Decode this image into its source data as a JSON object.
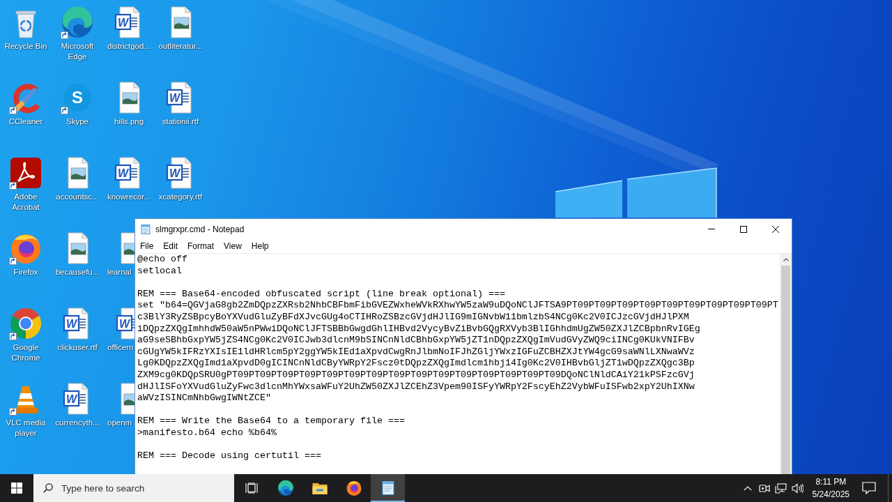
{
  "desktop_icons": [
    {
      "label": "Recycle Bin",
      "kind": "recycle-bin",
      "shortcut": false,
      "covered": false
    },
    {
      "label": "CCleaner",
      "kind": "ccleaner",
      "shortcut": true,
      "covered": false
    },
    {
      "label": "Adobe Acrobat",
      "kind": "acrobat",
      "shortcut": true,
      "covered": false
    },
    {
      "label": "Firefox",
      "kind": "firefox",
      "shortcut": true,
      "covered": false
    },
    {
      "label": "Google Chrome",
      "kind": "chrome",
      "shortcut": true,
      "covered": false
    },
    {
      "label": "VLC media player",
      "kind": "vlc",
      "shortcut": true,
      "covered": false
    },
    {
      "label": "Microsoft Edge",
      "kind": "edge",
      "shortcut": true,
      "covered": false
    },
    {
      "label": "Skype",
      "kind": "skype",
      "glyph": "S",
      "shortcut": true,
      "covered": false
    },
    {
      "label": "accountsc...",
      "kind": "image-file",
      "shortcut": false,
      "covered": false
    },
    {
      "label": "becausefu...",
      "kind": "image-file",
      "shortcut": false,
      "covered": false
    },
    {
      "label": "clickuser.rtf",
      "kind": "word-doc",
      "glyph": "W",
      "shortcut": false,
      "covered": false
    },
    {
      "label": "currencyth...",
      "kind": "word-doc",
      "glyph": "W",
      "shortcut": false,
      "covered": false
    },
    {
      "label": "districtgod...",
      "kind": "word-doc",
      "glyph": "W",
      "shortcut": false,
      "covered": false
    },
    {
      "label": "hills.png",
      "kind": "image-file",
      "shortcut": false,
      "covered": false
    },
    {
      "label": "knowrecor...",
      "kind": "word-doc",
      "glyph": "W",
      "shortcut": false,
      "covered": false
    },
    {
      "label": "learnal",
      "kind": "image-file",
      "shortcut": false,
      "covered": true
    },
    {
      "label": "officern",
      "kind": "word-doc",
      "glyph": "W",
      "shortcut": false,
      "covered": true
    },
    {
      "label": "openm",
      "kind": "image-file",
      "shortcut": false,
      "covered": true
    },
    {
      "label": "outliteratur...",
      "kind": "image-file",
      "shortcut": false,
      "covered": false
    },
    {
      "label": "stationii.rtf",
      "kind": "word-doc",
      "glyph": "W",
      "shortcut": false,
      "covered": false
    },
    {
      "label": "xcategory.rtf",
      "kind": "word-doc",
      "glyph": "W",
      "shortcut": false,
      "covered": false
    }
  ],
  "notepad": {
    "title": "slmgrxpr.cmd - Notepad",
    "menu": [
      "File",
      "Edit",
      "Format",
      "View",
      "Help"
    ],
    "blocks": [
      [
        "@echo off",
        "setlocal"
      ],
      [
        "REM === Base64-encoded obfuscated script (line break optional) ===",
        "set \"b64=QGVjaG8gb2ZmDQpzZXRsb2NhbCBFbmFibGVEZWxheWVkRXhwYW5zaW9uDQoNClJFTSA9PT09PT09PT09PT09PT09PT09PT09PT09PT09PT",
        "c3BlY3RyZSBpcyBoYXVudGluZyBFdXJvcGUg4oCTIHRoZSBzcGVjdHJlIG9mIGNvbW11bmlzbS4NCg0Kc2V0ICJzcGVjdHJlPXM",
        "iDQpzZXQgImhhdW50aW5nPWwiDQoNClJFTSBBbGwgdGhlIHBvd2VycyBvZiBvbGQgRXVyb3BlIGhhdmUgZW50ZXJlZCBpbnRvIGEg",
        "aG9seSBhbGxpYW5jZS4NCg0Kc2V0ICJwb3dlcnM9bSINCnNldCBhbGxpYW5jZT1nDQpzZXQgImVudGVyZWQ9ciINCg0KUkVNIFBv",
        "cGUgYW5kIFRzYXIsIE1ldHRlcm5pY2ggYW5kIEd1aXpvdCwgRnJlbmNoIFJhZGljYWxzIGFuZCBHZXJtYW4gcG9saWNlLXNwaWVz",
        "Lg0KDQpzZXQgImd1aXpvdD0gICINCnNldCByYWRpY2Fscz0tDQpzZXQgImdlcm1hbj14Ig0Kc2V0IHBvbGljZT1wDQpzZXQgc3Bp",
        "ZXM9cg0KDQpSRU0gPT09PT09PT09PT09PT09PT09PT09PT09PT09PT09PT09PT09PT09PT09PT09DQoNClNldCAiY21kPSFzcGVj",
        "dHJlISFoYXVudGluZyFwc3dlcnMhYWxsaWFuY2UhZW50ZXJlZCEhZ3Vpem90ISFyYWRpY2FscyEhZ2VybWFuISFwb2xpY2UhIXNw",
        "aWVzISINCmNhbGwgIWNtZCE\""
      ],
      [
        "REM === Write the Base64 to a temporary file ===",
        ">manifesto.b64 echo %b64%"
      ],
      [
        "REM === Decode using certutil ==="
      ]
    ]
  },
  "taskbar": {
    "search": {
      "placeholder": "Type here to search"
    },
    "apps": [
      {
        "kind": "edge",
        "running": false,
        "active": false
      },
      {
        "kind": "explorer",
        "running": false,
        "active": false
      },
      {
        "kind": "firefox",
        "running": false,
        "active": false
      },
      {
        "kind": "notepad",
        "running": true,
        "active": true
      }
    ],
    "time": "8:11 PM",
    "date": "5/24/2025"
  }
}
